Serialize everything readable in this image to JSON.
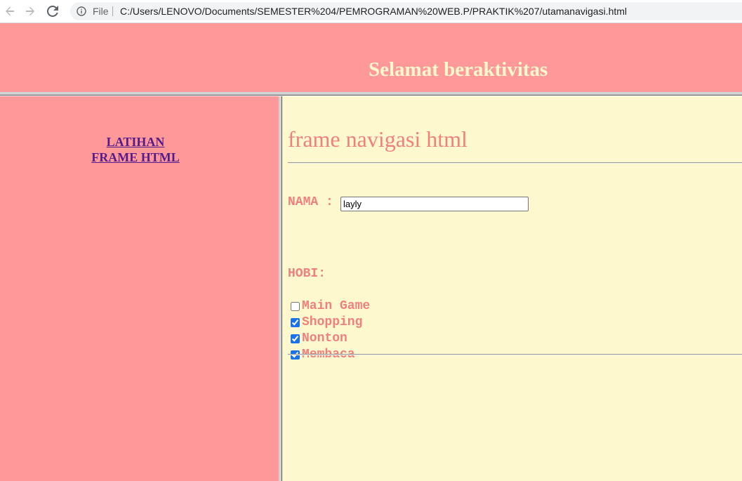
{
  "browser": {
    "scheme_label": "File",
    "url": "C:/Users/LENOVO/Documents/SEMESTER%204/PEMROGRAMAN%20WEB.P/PRAKTIK%207/utamanavigasi.html"
  },
  "top_frame": {
    "title": "Selamat beraktivitas"
  },
  "left_frame": {
    "link_line1": "LATIHAN",
    "link_line2": "FRAME HTML"
  },
  "right_frame": {
    "heading": "frame navigasi html",
    "nama_label": "NAMA :",
    "nama_value": "layly",
    "hobi_label": "HOBI:",
    "hobbies": [
      {
        "label": "Main Game",
        "checked": false
      },
      {
        "label": "Shopping",
        "checked": true
      },
      {
        "label": "Nonton",
        "checked": true
      },
      {
        "label": "Membaca",
        "checked": true
      }
    ]
  },
  "colors": {
    "frame_pink": "#ff9999",
    "frame_cream": "#fdf8cd",
    "text_coral": "#f08080",
    "link_purple": "#551a8b"
  }
}
